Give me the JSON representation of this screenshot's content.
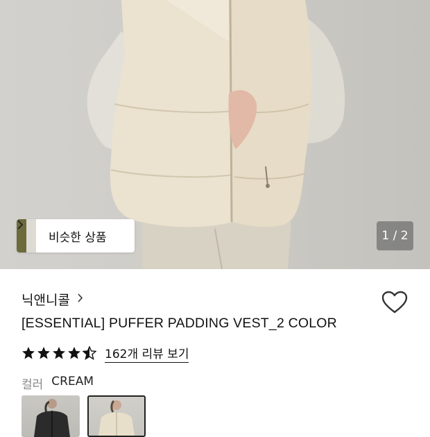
{
  "product_image": {
    "similar_button_label": "비슷한 상품",
    "counter": "1 / 2"
  },
  "brand": {
    "name": "닉앤니콜"
  },
  "product": {
    "title": "[ESSENTIAL] PUFFER PADDING VEST_2 COLOR",
    "rating": 4.5,
    "review_link": "162개 리뷰 보기"
  },
  "options": {
    "color_label": "컬러",
    "selected_color": "CREAM",
    "swatches": [
      "black",
      "cream"
    ]
  },
  "icons": {
    "chevron": "chevron-right-icon",
    "wishlist": "heart-outline-icon",
    "star": "star-icon"
  }
}
